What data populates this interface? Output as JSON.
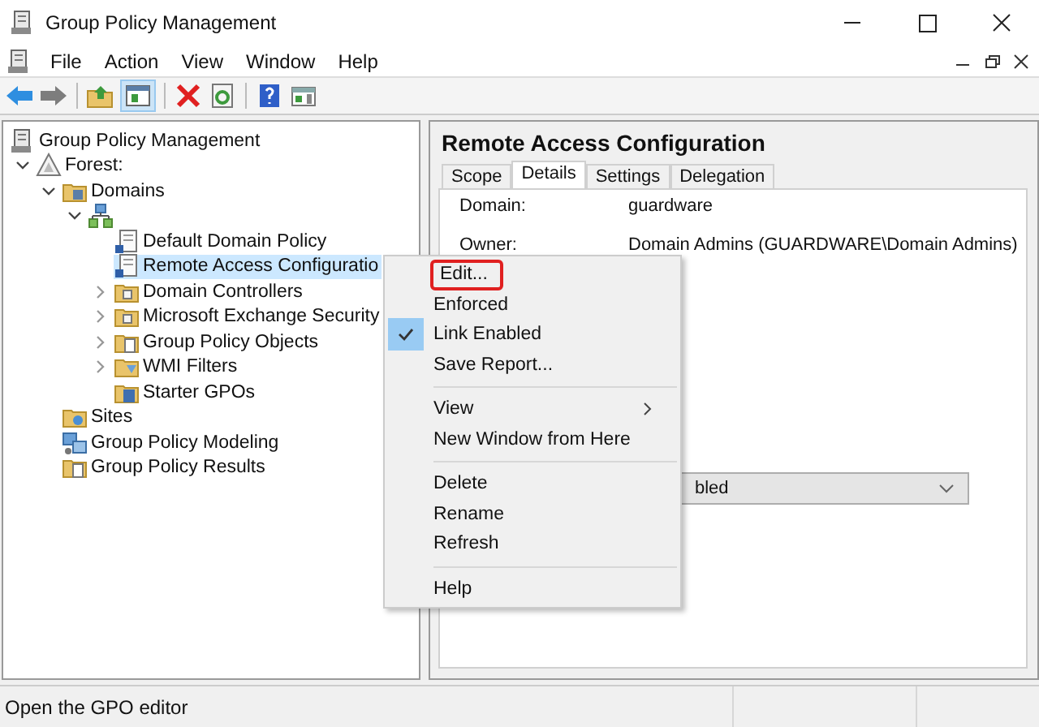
{
  "window": {
    "title": "Group Policy Management"
  },
  "menu_bar": [
    "File",
    "Action",
    "View",
    "Window",
    "Help"
  ],
  "tree": {
    "label": "Group Policy Management",
    "kind": "console",
    "children": [
      {
        "label": "Forest:",
        "kind": "forest",
        "expanded": true,
        "selected": false,
        "children": [
          {
            "label": "Domains",
            "kind": "domains",
            "expanded": true,
            "selected": false,
            "children": [
              {
                "kind": "domain",
                "expanded": true,
                "selected": false,
                "children": [
                  {
                    "label": "Default Domain Policy",
                    "kind": "gpo",
                    "selected": false
                  },
                  {
                    "label": "Remote Access Configuratio",
                    "kind": "gpo",
                    "selected": true
                  },
                  {
                    "label": "Domain Controllers",
                    "kind": "ou",
                    "expanded": false,
                    "selected": false
                  },
                  {
                    "label": "Microsoft Exchange Security",
                    "kind": "ou",
                    "expanded": false,
                    "selected": false
                  },
                  {
                    "label": "Group Policy Objects",
                    "kind": "gpofolder",
                    "expanded": false,
                    "selected": false
                  },
                  {
                    "label": "WMI Filters",
                    "kind": "wmi",
                    "expanded": false,
                    "selected": false
                  },
                  {
                    "label": "Starter GPOs",
                    "kind": "starter",
                    "selected": false
                  }
                ]
              }
            ]
          },
          {
            "label": "Sites",
            "kind": "sites",
            "selected": false
          },
          {
            "label": "Group Policy Modeling",
            "kind": "modeling",
            "selected": false
          },
          {
            "label": "Group Policy Results",
            "kind": "results",
            "selected": false
          }
        ]
      }
    ]
  },
  "details_pane": {
    "title": "Remote Access Configuration",
    "tabs": [
      {
        "label": "Scope",
        "selected": false
      },
      {
        "label": "Details",
        "selected": true
      },
      {
        "label": "Settings",
        "selected": false
      },
      {
        "label": "Delegation",
        "selected": false
      }
    ],
    "fields": [
      {
        "label": "Domain:",
        "value": "guardware"
      },
      {
        "label": "Owner:",
        "value": "Domain Admins (GUARDWARE\\Domain Admins)"
      }
    ],
    "dropdown": {
      "value": "bled"
    }
  },
  "context_menu": [
    [
      {
        "label": "Edit...",
        "checked": false,
        "submenu": false,
        "outlined": true
      },
      {
        "label": "Enforced",
        "checked": false,
        "submenu": false,
        "outlined": false
      },
      {
        "label": "Link Enabled",
        "checked": true,
        "submenu": false,
        "outlined": false
      },
      {
        "label": "Save Report...",
        "checked": false,
        "submenu": false,
        "outlined": false
      }
    ],
    [
      {
        "label": "View",
        "checked": false,
        "submenu": true,
        "outlined": false
      },
      {
        "label": "New Window from Here",
        "checked": false,
        "submenu": false,
        "outlined": false
      }
    ],
    [
      {
        "label": "Delete",
        "checked": false,
        "submenu": false,
        "outlined": false
      },
      {
        "label": "Rename",
        "checked": false,
        "submenu": false,
        "outlined": false
      },
      {
        "label": "Refresh",
        "checked": false,
        "submenu": false,
        "outlined": false
      }
    ],
    [
      {
        "label": "Help",
        "checked": false,
        "submenu": false,
        "outlined": false
      }
    ]
  ],
  "status_bar": {
    "text": "Open the GPO editor"
  }
}
